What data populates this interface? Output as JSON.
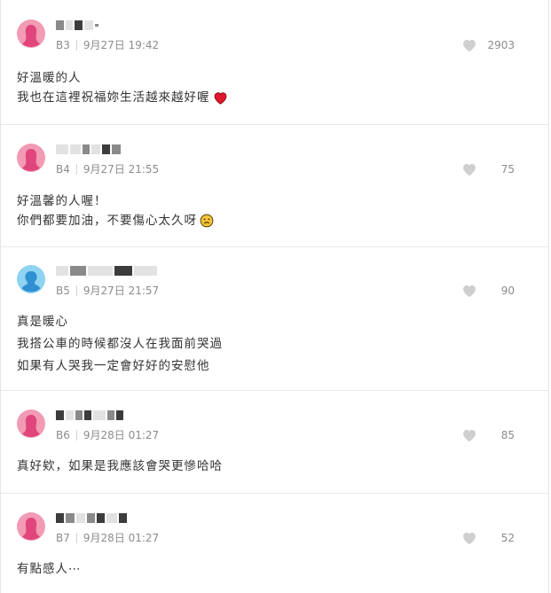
{
  "comments": [
    {
      "floor": "B3",
      "date": "9月27日 19:42",
      "likes": "2903",
      "avatar_color": "pink",
      "lines": [
        "好溫暖的人",
        "我也在這裡祝福妳生活越來越好喔"
      ],
      "emoji": "heart-emoji"
    },
    {
      "floor": "B4",
      "date": "9月27日 21:55",
      "likes": "75",
      "avatar_color": "pink",
      "lines": [
        "好溫馨的人喔！",
        "你們都要加油，不要傷心太久呀"
      ],
      "emoji": "worried-face-emoji"
    },
    {
      "floor": "B5",
      "date": "9月27日 21:57",
      "likes": "90",
      "avatar_color": "blue",
      "lines": [
        "真是暖心",
        "我搭公車的時候都沒人在我面前哭過",
        "如果有人哭我一定會好好的安慰他"
      ]
    },
    {
      "floor": "B6",
      "date": "9月28日 01:27",
      "likes": "85",
      "avatar_color": "pink",
      "lines": [
        "真好欸，如果是我應該會哭更慘哈哈"
      ]
    },
    {
      "floor": "B7",
      "date": "9月28日 01:27",
      "likes": "52",
      "avatar_color": "pink",
      "lines": [
        "有點感人⋯"
      ]
    }
  ],
  "colors": {
    "avatar_pink": "#f29bb4",
    "avatar_blue": "#8fd3f2",
    "silhouette_pink": "#e0457b",
    "silhouette_blue": "#2f8fd0",
    "heart_gray": "#cfcfcf",
    "emoji_heart": "#e0182d"
  }
}
